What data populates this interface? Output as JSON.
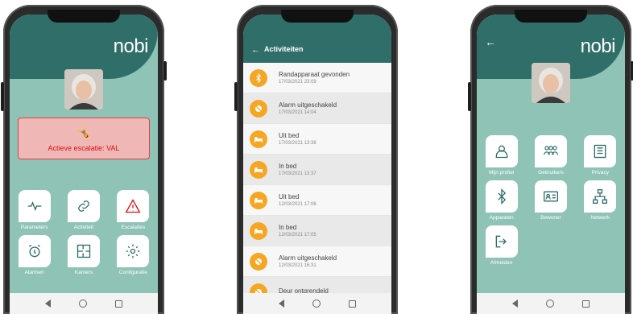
{
  "phone1": {
    "logo": "nobi",
    "alert": "Actieve escalatie: VAL",
    "tiles": [
      {
        "label": "Parameters",
        "icon": "pulse-icon"
      },
      {
        "label": "Activiteit",
        "icon": "link-icon"
      },
      {
        "label": "Escalaties",
        "icon": "warning-icon"
      },
      {
        "label": "Alarmen",
        "icon": "alarm-clock-icon"
      },
      {
        "label": "Kamers",
        "icon": "floorplan-icon"
      },
      {
        "label": "Configuratie",
        "icon": "gear-icon"
      }
    ]
  },
  "phone2": {
    "title": "Activiteiten",
    "back": "←",
    "items": [
      {
        "title": "Randapparaat gevonden",
        "date": "17/03/2021 23:09",
        "icon": "bluetooth-icon"
      },
      {
        "title": "Alarm uitgeschakeld",
        "date": "17/03/2021 14:04",
        "icon": "alarm-off-icon"
      },
      {
        "title": "Uit bed",
        "date": "17/03/2021 13:38",
        "icon": "bed-icon"
      },
      {
        "title": "In bed",
        "date": "17/03/2021 13:37",
        "icon": "bed-icon"
      },
      {
        "title": "Uit bed",
        "date": "12/03/2021 17:06",
        "icon": "bed-icon"
      },
      {
        "title": "In bed",
        "date": "12/03/2021 17:05",
        "icon": "bed-icon"
      },
      {
        "title": "Alarm uitgeschakeld",
        "date": "12/03/2021 16:31",
        "icon": "alarm-off-icon"
      },
      {
        "title": "Deur ontgrendeld",
        "date": "",
        "icon": "alarm-off-icon"
      }
    ]
  },
  "phone3": {
    "logo": "nobi",
    "back": "←",
    "tiles": [
      {
        "label": "Mijn profiel",
        "icon": "user-icon"
      },
      {
        "label": "Gebruikers",
        "icon": "users-icon"
      },
      {
        "label": "Privacy",
        "icon": "privacy-icon"
      },
      {
        "label": "Apparaten",
        "icon": "bluetooth-icon"
      },
      {
        "label": "Bewoner",
        "icon": "id-card-icon"
      },
      {
        "label": "Netwerk",
        "icon": "network-icon"
      },
      {
        "label": "Afmelden",
        "icon": "logout-icon"
      }
    ]
  },
  "colors": {
    "teal_dark": "#2f6e69",
    "teal_light": "#8ec3b6",
    "orange": "#f5a623",
    "alert_red": "#dd1111"
  }
}
